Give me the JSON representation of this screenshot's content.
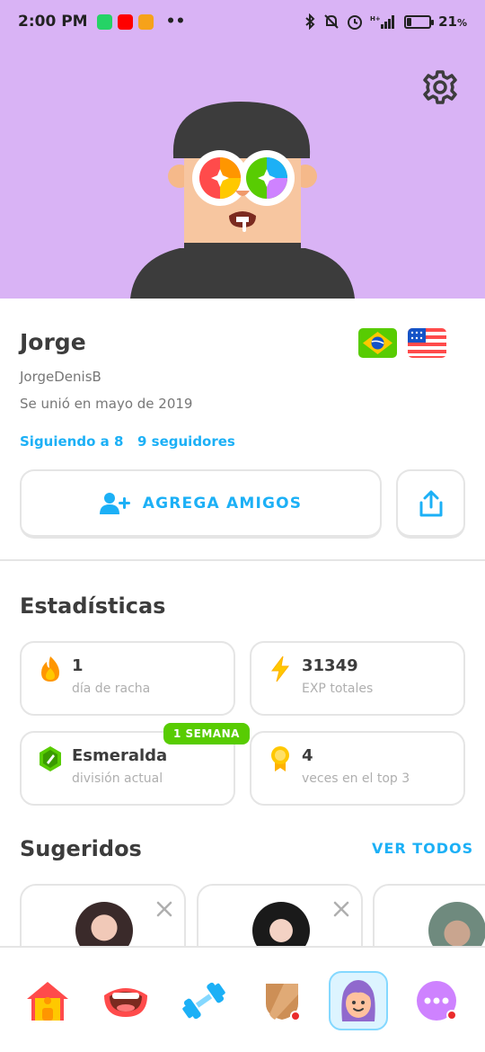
{
  "statusbar": {
    "time": "2:00 PM",
    "more": "••",
    "battery_percent": "21",
    "percent_sign": "%",
    "battery_level": 0.21
  },
  "profile": {
    "name": "Jorge",
    "username": "JorgeDenisB",
    "joined": "Se unió en mayo de 2019",
    "following": "Siguiendo a 8",
    "followers": "9 seguidores",
    "flags": [
      "brazil-flag",
      "usa-flag"
    ]
  },
  "actions": {
    "add_friends": "AGREGA AMIGOS"
  },
  "stats": {
    "title": "Estadísticas",
    "items": [
      {
        "value": "1",
        "label": "día de racha",
        "icon": "flame-icon"
      },
      {
        "value": "31349",
        "label": "EXP totales",
        "icon": "lightning-icon"
      },
      {
        "value": "Esmeralda",
        "label": "división actual",
        "icon": "emerald-league-icon",
        "badge": "1 SEMANA"
      },
      {
        "value": "4",
        "label": "veces en el top 3",
        "icon": "medal-icon"
      }
    ]
  },
  "suggested": {
    "title": "Sugeridos",
    "see_all": "VER TODOS"
  },
  "colors": {
    "header_bg": "#d9b3f5",
    "accent_blue": "#1cb0f6",
    "badge_green": "#58cc02",
    "border": "#e5e5e5",
    "notification_red": "#ea2b2b"
  },
  "nav": [
    "home-icon",
    "speaking-mouth-icon",
    "dumbbell-icon",
    "shield-icon",
    "profile-icon",
    "more-icon"
  ]
}
